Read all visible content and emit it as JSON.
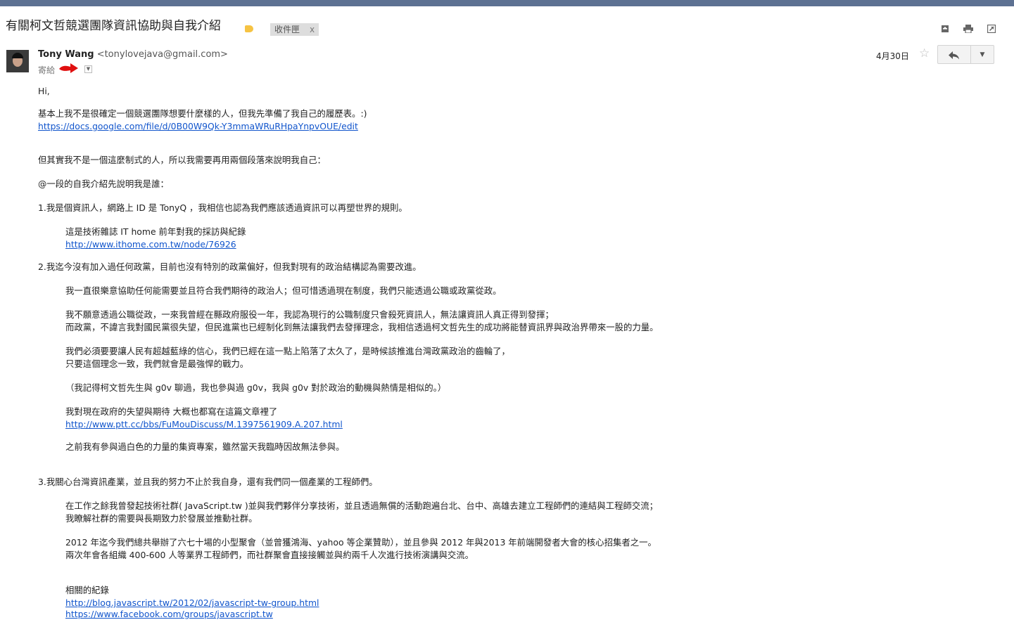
{
  "thread": {
    "subject": "有關柯文哲競選團隊資訊協助與自我介紹",
    "label_chip": "收件匣",
    "label_remove": "x"
  },
  "toolbar": {
    "icons": [
      "archive-icon",
      "print-icon",
      "new-window-icon"
    ]
  },
  "message": {
    "sender_name": "Tony Wang",
    "sender_email": "<tonylovejava@gmail.com>",
    "to_label": "寄給",
    "date": "4月30日",
    "reply_icon": "reply-icon",
    "more_icon": "chevron-down-icon",
    "colors": {
      "link": "#1155cc",
      "topbar": "#5d7192",
      "label": "#f6c343"
    }
  },
  "body": {
    "greeting": "Hi,",
    "p1_line1": "基本上我不是很確定一個競選團隊想要什麼樣的人，但我先準備了我自己的履歷表。:)",
    "p1_link": "https://docs.google.com/file/d/0B00W9Qk-Y3mmaWRuRHpaYnpvOUE/edit",
    "p2": "但其實我不是一個這麼制式的人，所以我需要再用兩個段落來說明我自己：",
    "p3": "@一段的自我介紹先說明我是誰：",
    "item1": "1.我是個資訊人，網路上 ID 是 TonyQ ，我相信也認為我們應該透過資訊可以再塑世界的規則。",
    "item1_sub1": "這是技術雜誌 IT home 前年對我的採訪與紀錄",
    "item1_link": "http://www.ithome.com.tw/node/76926",
    "item2": "2.我迄今沒有加入過任何政黨，目前也沒有特別的政黨偏好，但我對現有的政治結構認為需要改進。",
    "item2_a": "我一直很樂意協助任何能需要並且符合我們期待的政治人；但可惜透過現在制度，我們只能透過公職或政黨從政。",
    "item2_b1": "我不願意透過公職從政，一來我曾經在縣政府服役一年，我認為現行的公職制度只會殺死資訊人，無法讓資訊人真正得到發揮；",
    "item2_b2": "而政黨，不諱言我對國民黨很失望，但民進黨也已經制化到無法讓我們去發揮理念，我相信透過柯文哲先生的成功將能替資訊界與政治界帶來一股的力量。",
    "item2_c1": "我們必須要要讓人民有超越藍綠的信心，我們已經在這一點上陷落了太久了，是時候該推進台灣政黨政治的齒輪了，",
    "item2_c2": "只要這個理念一致，我們就會是最強悍的戰力。",
    "item2_d": "（我記得柯文哲先生與 g0v 聊過，我也參與過 g0v，我與 g0v 對於政治的動機與熱情是相似的。）",
    "item2_e1": "我對現在政府的失望與期待  大概也都寫在這篇文章裡了",
    "item2_e_link": "http://www.ptt.cc/bbs/FuMouDiscuss/M.1397561909.A.207.html",
    "item2_f": "之前我有參與過白色的力量的集資專案，雖然當天我臨時因故無法參與。",
    "item3": "3.我關心台灣資訊產業，並且我的努力不止於我自身，還有我們同一個產業的工程師們。",
    "item3_a1": "在工作之餘我曾發起技術社群( JavaScript.tw )並與我們夥伴分享技術，並且透過無償的活動跑遍台北、台中、高雄去建立工程師們的連結與工程師交流；",
    "item3_a2": "我瞭解社群的需要與長期致力於發展並推動社群。",
    "item3_b1": "2012 年迄今我們總共舉辦了六七十場的小型聚會（並曾獲鴻海、yahoo 等企業贊助），並且參與 2012 年與2013 年前端開發者大會的核心招集者之一。",
    "item3_b2": "兩次年會各組織 400-600 人等業界工程師們，而社群聚會直接接觸並與約兩千人次進行技術演講與交流。",
    "related": "相關的紀錄",
    "related_link1": "http://blog.javascript.tw/2012/02/javascript-tw-group.html",
    "related_link2": "https://www.facebook.com/groups/javascript.tw"
  }
}
